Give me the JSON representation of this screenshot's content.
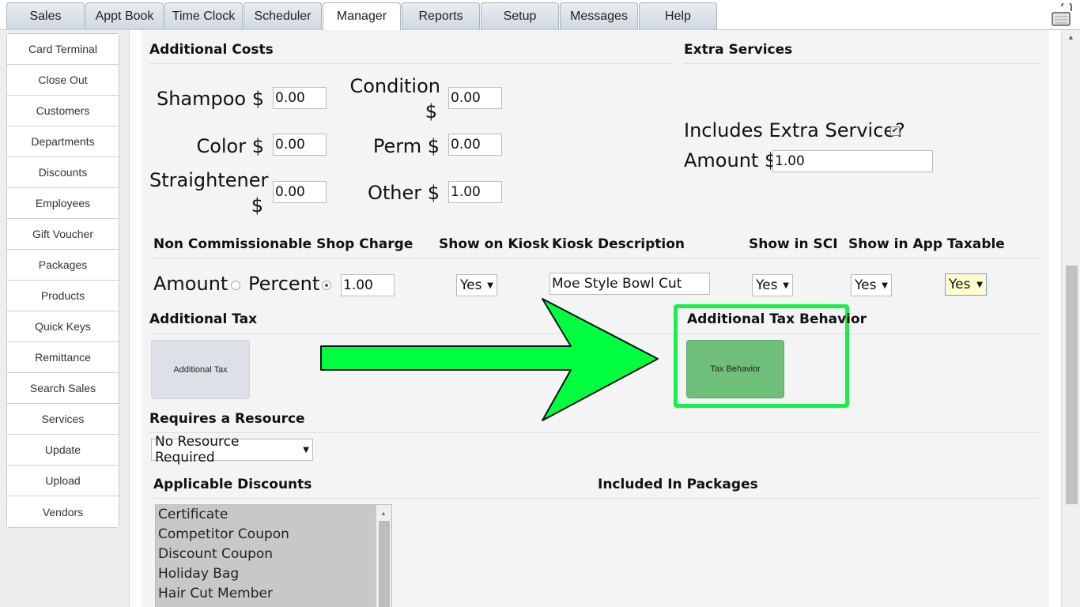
{
  "tabs": [
    {
      "label": "Sales"
    },
    {
      "label": "Appt Book"
    },
    {
      "label": "Time Clock"
    },
    {
      "label": "Scheduler"
    },
    {
      "label": "Manager"
    },
    {
      "label": "Reports"
    },
    {
      "label": "Setup"
    },
    {
      "label": "Messages"
    },
    {
      "label": "Help"
    }
  ],
  "active_tab": "Manager",
  "sidebar": {
    "items": [
      {
        "label": "Card Terminal"
      },
      {
        "label": "Close Out"
      },
      {
        "label": "Customers"
      },
      {
        "label": "Departments"
      },
      {
        "label": "Discounts"
      },
      {
        "label": "Employees"
      },
      {
        "label": "Gift Voucher"
      },
      {
        "label": "Packages"
      },
      {
        "label": "Products"
      },
      {
        "label": "Quick Keys"
      },
      {
        "label": "Remittance"
      },
      {
        "label": "Search Sales"
      },
      {
        "label": "Services"
      },
      {
        "label": "Update"
      },
      {
        "label": "Upload"
      },
      {
        "label": "Vendors"
      }
    ]
  },
  "additional_costs": {
    "heading": "Additional Costs",
    "shampoo_label": "Shampoo $",
    "shampoo_value": "0.00",
    "condition_label": "Condition",
    "condition_dollar": "$",
    "condition_value": "0.00",
    "color_label": "Color $",
    "color_value": "0.00",
    "perm_label": "Perm $",
    "perm_value": "0.00",
    "straightener_label": "Straightener",
    "straightener_dollar": "$",
    "straightener_value": "0.00",
    "other_label": "Other $",
    "other_value": "1.00"
  },
  "extra_services": {
    "heading": "Extra Services",
    "includes_label": "Includes Extra Service?",
    "includes_checked": true,
    "amount_label": "Amount $",
    "amount_value": "1.00"
  },
  "shop_charge": {
    "heading": "Non Commissionable Shop Charge",
    "amount_label": "Amount",
    "percent_label": "Percent",
    "selected": "Percent",
    "value": "1.00"
  },
  "kiosk": {
    "show_heading": "Show on Kiosk",
    "show_value": "Yes",
    "desc_heading": "Kiosk Description",
    "desc_value": "Moe Style Bowl Cut"
  },
  "sci": {
    "heading": "Show in SCI",
    "value": "Yes"
  },
  "app": {
    "heading": "Show in App",
    "value": "Yes"
  },
  "taxable": {
    "heading": "Taxable",
    "value": "Yes"
  },
  "additional_tax": {
    "heading": "Additional Tax",
    "button_label": "Additional Tax"
  },
  "tax_behavior": {
    "heading": "Additional Tax Behavior",
    "button_label": "Tax Behavior",
    "highlight_color": "#17f04a",
    "arrow_color": "#00ff40"
  },
  "resource": {
    "heading": "Requires a Resource",
    "value": "No Resource Required"
  },
  "discounts": {
    "heading": "Applicable Discounts",
    "options": [
      {
        "label": "Certificate"
      },
      {
        "label": "Competitor Coupon"
      },
      {
        "label": "Discount Coupon"
      },
      {
        "label": "Holiday Bag"
      },
      {
        "label": "Hair Cut Member"
      }
    ]
  },
  "packages": {
    "heading": "Included In Packages"
  }
}
